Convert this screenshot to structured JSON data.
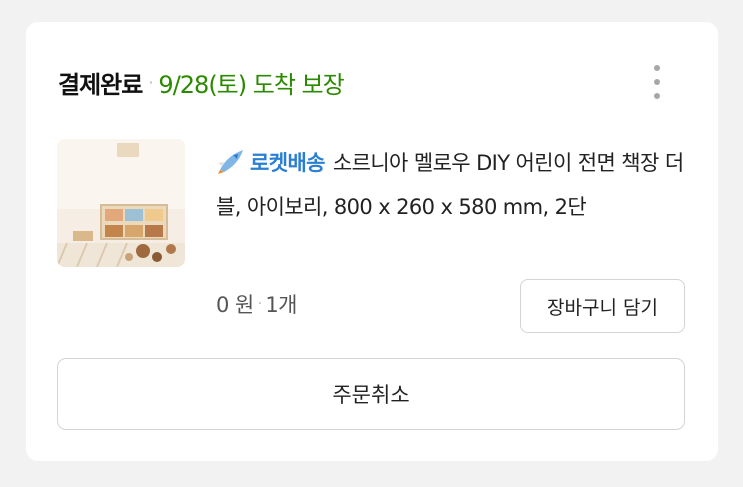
{
  "order": {
    "status": "결제완료",
    "separator": "·",
    "arrival": "9/28(토) 도착 보장",
    "more_icon": "vertical-ellipsis-icon"
  },
  "product": {
    "image": "bookshelf-product-thumbnail",
    "badge_icon": "rocket-icon",
    "badge": "로켓배송",
    "name": "소르니아 멜로우 DIY 어린이 전면 책장 더블, 아이보리, 800 x 260 x 580 mm, 2단",
    "price": "0 원",
    "separator": "·",
    "quantity": "1개"
  },
  "actions": {
    "cart_label": "장바구니 담기",
    "cancel_label": "주문취소"
  },
  "colors": {
    "status_green": "#2b8a00",
    "badge_blue": "#2b7fd2",
    "background": "#f2f2f3"
  }
}
